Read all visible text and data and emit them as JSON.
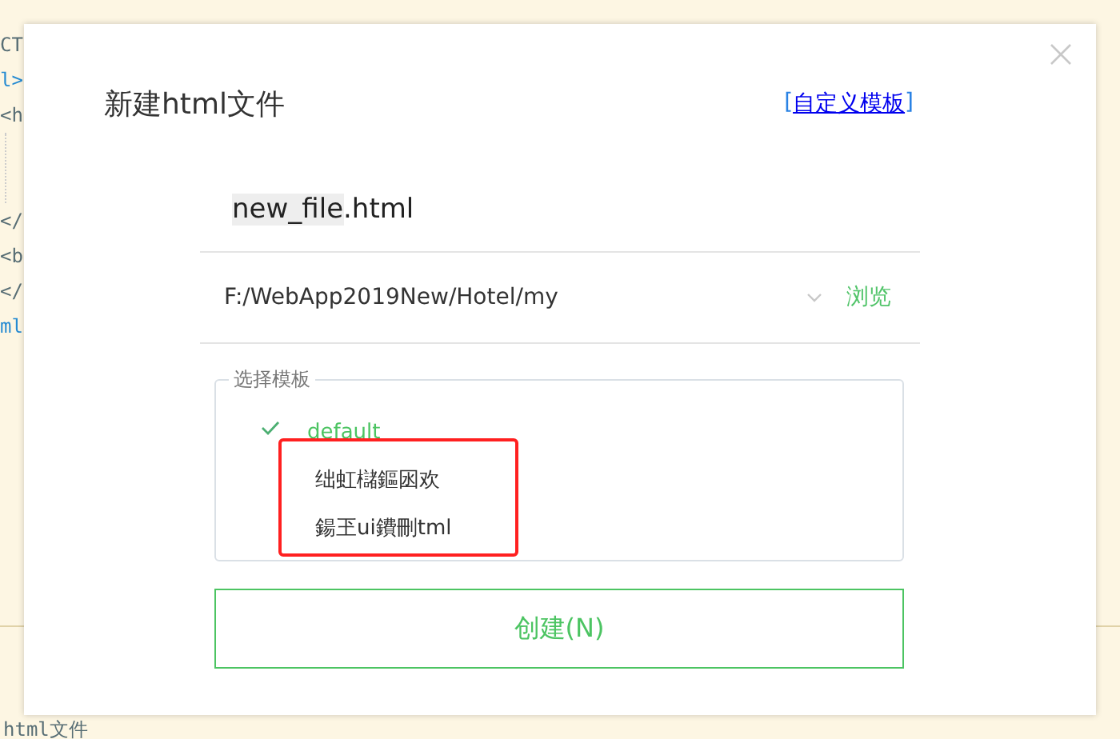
{
  "editor": {
    "code_lines_top": [
      "CT",
      "l>",
      "<h"
    ],
    "code_lines_bottom": [
      "</",
      "<b",
      "</",
      "ml"
    ],
    "footer_text": "html文件"
  },
  "dialog": {
    "title": "新建html文件",
    "custom_template_link": "自定义模板",
    "link_brackets": [
      "[",
      "]"
    ],
    "file_name": {
      "selected_part": "new_file",
      "rest": ".html"
    },
    "path": {
      "value": "F:/WebApp2019New/Hotel/my",
      "browse": "浏览"
    },
    "templates": {
      "legend": "选择模板",
      "items": [
        {
          "label": "default",
          "selected": true,
          "highlighted": false
        },
        {
          "label": "绌虹櫧鏂囦欢",
          "selected": false,
          "highlighted": true
        },
        {
          "label": "鍚玊ui鐨刪tml",
          "selected": false,
          "highlighted": true
        }
      ]
    },
    "create_button": "创建(N)"
  }
}
